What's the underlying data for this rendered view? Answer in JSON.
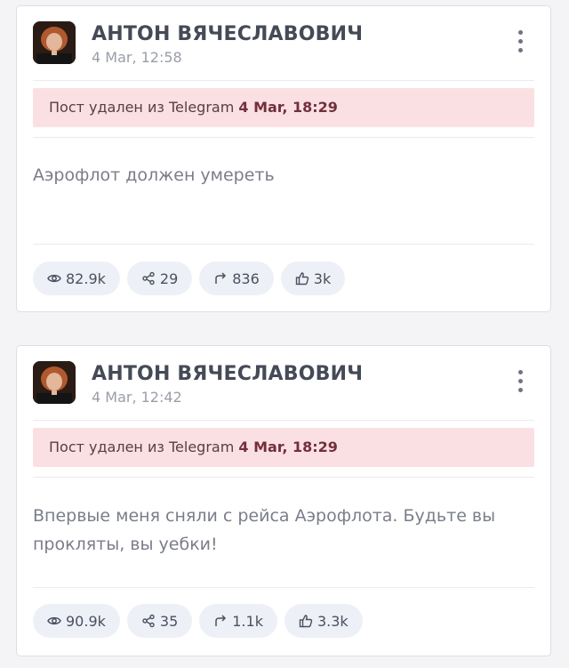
{
  "posts": [
    {
      "author": "АНТОН ВЯЧЕСЛАВОВИЧ",
      "date": "4 Mar, 12:58",
      "deleted_prefix": "Пост удален из Telegram",
      "deleted_date": "4 Mar, 18:29",
      "text": "Аэрофлот должен умереть",
      "views": "82.9k",
      "shares": "29",
      "forwards": "836",
      "likes": "3k"
    },
    {
      "author": "АНТОН ВЯЧЕСЛАВОВИЧ",
      "date": "4 Mar, 12:42",
      "deleted_prefix": "Пост удален из Telegram",
      "deleted_date": "4 Mar, 18:29",
      "text": "Впервые меня сняли с рейса Аэрофлота. Будьте вы прокляты, вы уебки!",
      "views": "90.9k",
      "shares": "35",
      "forwards": "1.1k",
      "likes": "3.3k"
    }
  ],
  "icons": {
    "views": "eye-icon",
    "shares": "share-nodes-icon",
    "forwards": "forward-arrow-icon",
    "likes": "thumbs-up-icon",
    "menu": "more-vertical-icon"
  },
  "colors": {
    "deleted_banner": "#fbe0e3",
    "pill_bg": "#eef0f7",
    "author_text": "#454a57"
  }
}
